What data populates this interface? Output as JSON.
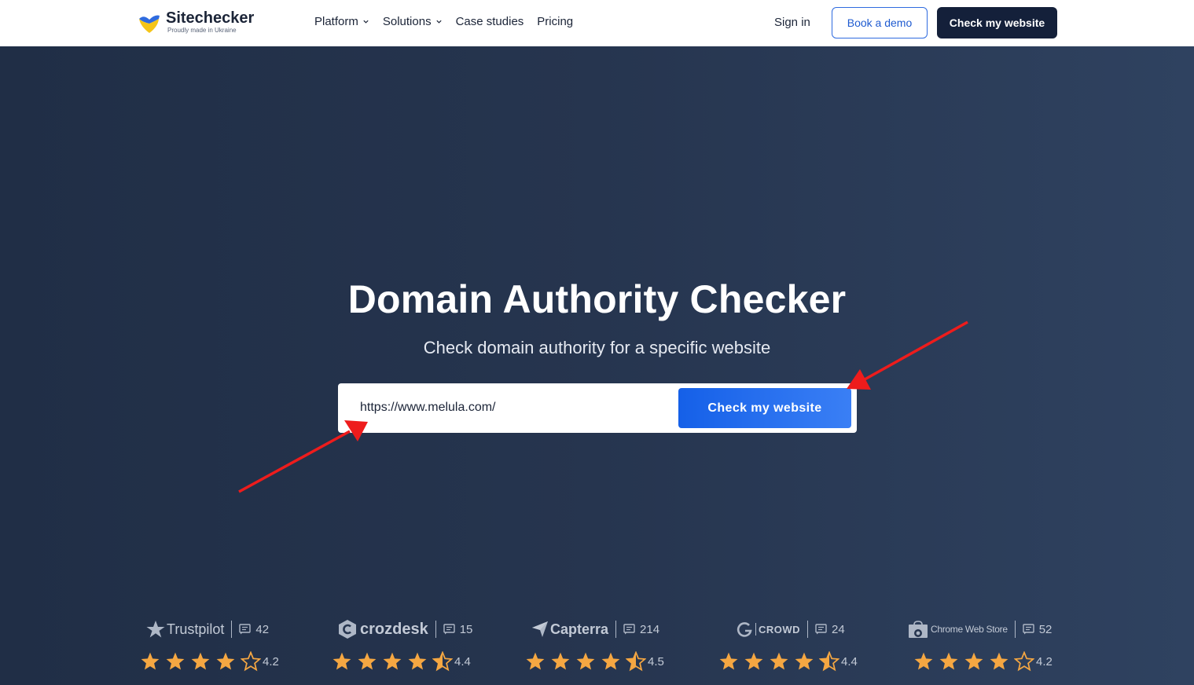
{
  "header": {
    "logo": {
      "name": "Sitechecker",
      "tagline": "Proudly made in Ukraine"
    },
    "nav": [
      {
        "label": "Platform",
        "has_dropdown": true
      },
      {
        "label": "Solutions",
        "has_dropdown": true
      },
      {
        "label": "Case studies",
        "has_dropdown": false
      },
      {
        "label": "Pricing",
        "has_dropdown": false
      }
    ],
    "sign_in": "Sign in",
    "book_demo": "Book a demo",
    "check_website": "Check my website"
  },
  "hero": {
    "title": "Domain Authority Checker",
    "subtitle": "Check domain authority for a specific website",
    "input_value": "https://www.melula.com/",
    "button": "Check my website"
  },
  "ratings": [
    {
      "brand": "Trustpilot",
      "icon": "trustpilot-star-icon",
      "count": "42",
      "score": 4.2,
      "score_label": "4.2"
    },
    {
      "brand": "crozdesk",
      "icon": "crozdesk-icon",
      "count": "15",
      "score": 4.4,
      "score_label": "4.4"
    },
    {
      "brand": "Capterra",
      "icon": "capterra-icon",
      "count": "214",
      "score": 4.5,
      "score_label": "4.5"
    },
    {
      "brand": "CROWD",
      "icon": "g2-icon",
      "count": "24",
      "score": 4.4,
      "score_label": "4.4"
    },
    {
      "brand": "Chrome Web Store",
      "icon": "chrome-web-store-icon",
      "count": "52",
      "score": 4.2,
      "score_label": "4.2"
    }
  ],
  "colors": {
    "hero_bg": "#26354f",
    "primary_button": "#1560e8",
    "dark_button": "#14203a",
    "star": "#f5a742",
    "annotation_arrow": "#ee1c1c"
  }
}
